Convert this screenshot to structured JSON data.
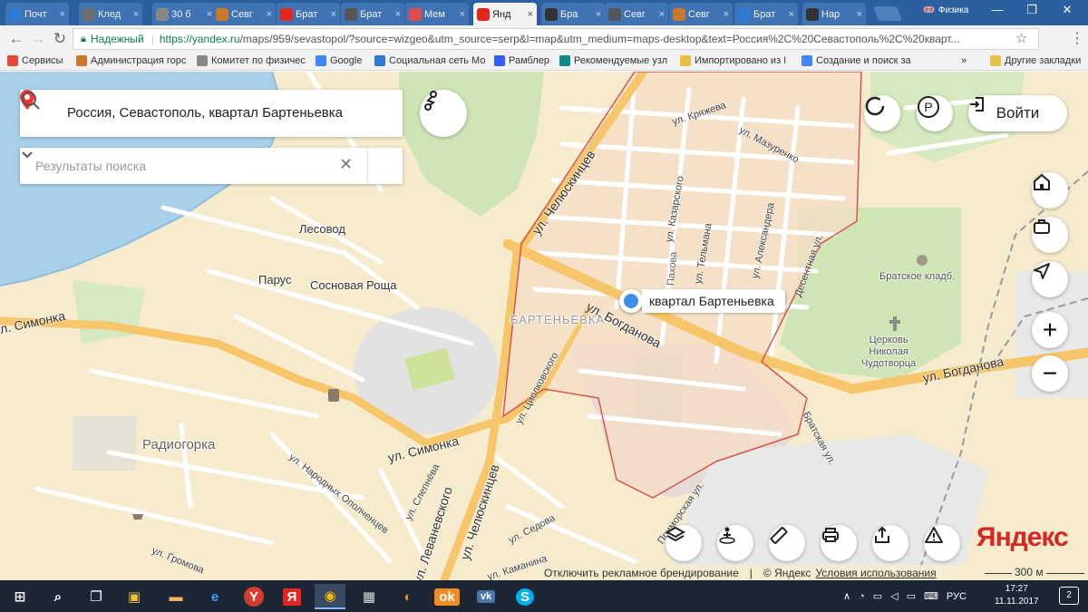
{
  "tabs": [
    {
      "label": "Почт",
      "icon": "mail-icon",
      "color": "#2e7bd6"
    },
    {
      "label": "Клед",
      "icon": "book-icon",
      "color": "#6e6e6e"
    },
    {
      "label": "30 б",
      "icon": "document-icon",
      "color": "#888888"
    },
    {
      "label": "Севг",
      "icon": "emblem-icon",
      "color": "#c9772b"
    },
    {
      "label": "Брат",
      "icon": "yandex-icon",
      "color": "#e52620"
    },
    {
      "label": "Брат",
      "icon": "person-icon",
      "color": "#555555"
    },
    {
      "label": "Мем",
      "icon": "spiral-icon",
      "color": "#e04a4a"
    },
    {
      "label": "Янд",
      "icon": "map-pin-icon",
      "color": "#e52620"
    },
    {
      "label": "Бра",
      "icon": "wikipedia-icon",
      "color": "#333333"
    },
    {
      "label": "Севг",
      "icon": "person-icon",
      "color": "#555555"
    },
    {
      "label": "Севг",
      "icon": "emblem-icon",
      "color": "#c9772b"
    },
    {
      "label": "Брат",
      "icon": "globe-icon",
      "color": "#2e7bd6"
    },
    {
      "label": "Нар",
      "icon": "wikipedia-icon",
      "color": "#333333"
    }
  ],
  "active_tab_index": 7,
  "profile": {
    "name": "Физика"
  },
  "window_controls": {
    "minimize": "—",
    "maximize": "❐",
    "close": "✕"
  },
  "address": {
    "secure_label": "Надежный",
    "url_host": "https://yandex.ru",
    "url_rest": "/maps/959/sevastopol/?source=wizgeo&utm_source=serp&l=map&utm_medium=maps-desktop&text=Россия%2C%20Севастополь%2C%20кварт..."
  },
  "bookmarks": [
    {
      "label": "Сервисы",
      "icon": "apps-grid-icon",
      "color": "#e34a3a"
    },
    {
      "label": "Администрация горс",
      "icon": "emblem-icon",
      "color": "#c9772b"
    },
    {
      "label": "Комитет по физичес",
      "icon": "document-icon",
      "color": "#888888"
    },
    {
      "label": "Google",
      "icon": "google-icon",
      "color": "#4285f4"
    },
    {
      "label": "Социальная сеть Мо",
      "icon": "square-icon",
      "color": "#2e7bd6"
    },
    {
      "label": "Рамблер",
      "icon": "rambler-icon",
      "color": "#315efb"
    },
    {
      "label": "Рекомендуемые узл",
      "icon": "bing-icon",
      "color": "#0f8a88"
    },
    {
      "label": "Импортировано из I",
      "icon": "folder-icon",
      "color": "#e7c047"
    },
    {
      "label": "Создание и поиск за",
      "icon": "google-icon",
      "color": "#4285f4"
    },
    {
      "label": "»",
      "icon": "more-icon",
      "color": "#555555"
    },
    {
      "label": "Другие закладки",
      "icon": "folder-icon",
      "color": "#e7c047"
    }
  ],
  "search": {
    "query": "Россия, Севастополь, квартал Бартеньевка",
    "results_placeholder": "Результаты поиска"
  },
  "login": {
    "label": "Войти"
  },
  "place": {
    "label": "квартал Бартеньевка",
    "accent": "#3d8dea"
  },
  "map_labels": {
    "lesovod": "Лесовод",
    "parus": "Парус",
    "sosnovaya_roscha": "Сосновая Роща",
    "barteneva": "БАРТЕНЬЕВКА",
    "radiogorka": "Радиогорка",
    "bratskoe": "Братское кладб.",
    "church": [
      "Церковь",
      "Николая",
      "Чудотворца"
    ]
  },
  "streets": {
    "chelyuskintsev_top": "ул. Челюскинцев",
    "chelyuskintsev_bottom": "ул. Челюскинцев",
    "kryazheva": "ул. Кряжева",
    "mazurenko": "ул. Мазуренко",
    "kazarskogo": "ул. Казарского",
    "telmana": "ул. Тельмана",
    "aleksandera": "ул. Александера",
    "desentnaya": "Десентная ул.",
    "bogdanova_1": "ул. Богданова",
    "bogdanova_2": "ул. Богданова",
    "simonka_left": "л. Симонка",
    "simonka": "ул. Симонка",
    "tsiolkovskogo": "ул. Циолковского",
    "bratskaya": "Братская ул.",
    "primorskaya": "Приморская ул.",
    "narodnyh_opolchentsev": "ул. Народных Ополченцев",
    "slepneva": "ул. Слепнёва",
    "levanevskogo": "ул. Леваневского",
    "sedova": "ул. Седова",
    "kamanina": "ул. Каманина",
    "gromova": "ул. Громова",
    "pakhova": "Пахова"
  },
  "footer": {
    "ad_branding": "Отключить рекламное брендирование",
    "copyright": "© Яндекс",
    "terms": "Условия использования",
    "scale": "300 м"
  },
  "logo": "Яндекс",
  "taskbar": {
    "language": "РУС",
    "time": "17:27",
    "date": "11.11.2017",
    "notifications": "2"
  },
  "colors": {
    "tabbar": "#2b5fa0",
    "map_background": "#f6ebcd",
    "water": "#a8d0ea",
    "park": "#cfe5b6",
    "district_border": "#d9534f",
    "main_road": "#f7c66a",
    "yandex_red": "#d52822"
  }
}
